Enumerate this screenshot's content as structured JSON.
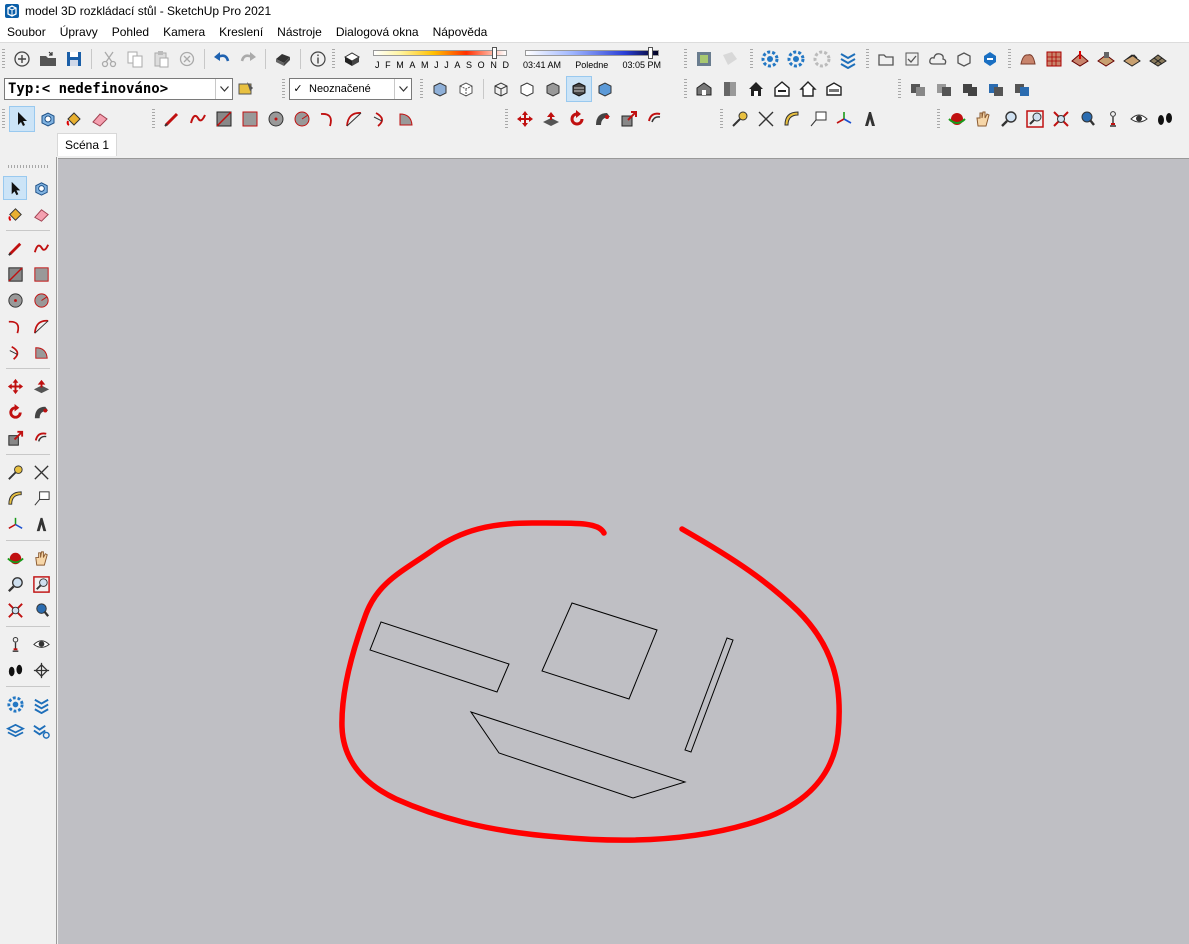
{
  "window": {
    "title": "model 3D rozkládací stůl - SketchUp Pro 2021"
  },
  "menu": [
    "Soubor",
    "Úpravy",
    "Pohled",
    "Kamera",
    "Kreslení",
    "Nástroje",
    "Dialogová okna",
    "Nápověda"
  ],
  "toolbar": {
    "shadows": {
      "months": [
        "J",
        "F",
        "M",
        "A",
        "M",
        "J",
        "J",
        "A",
        "S",
        "O",
        "N",
        "D"
      ],
      "month_position": 0.92,
      "time_start": "03:41 AM",
      "time_mid": "Poledne",
      "time_end": "03:05 PM",
      "time_position": 0.95
    },
    "type_combo": "Typ:< nedefinováno>",
    "tag_combo": "Neoznačené",
    "tag_combo_checked": "✓"
  },
  "scenes": {
    "tabs": [
      "Scéna 1"
    ]
  },
  "colors": {
    "viewport": "#bfbfc4",
    "annotation": "#ff0000",
    "toolbar_bg": "#f0f0f0",
    "active_tool": "#cce4f7"
  },
  "viewport": {
    "model_faces": [
      "rectangle-left",
      "square-center",
      "thin-panel-right",
      "trapezoid-bottom"
    ],
    "annotation": "red-hand-drawn-circle"
  }
}
